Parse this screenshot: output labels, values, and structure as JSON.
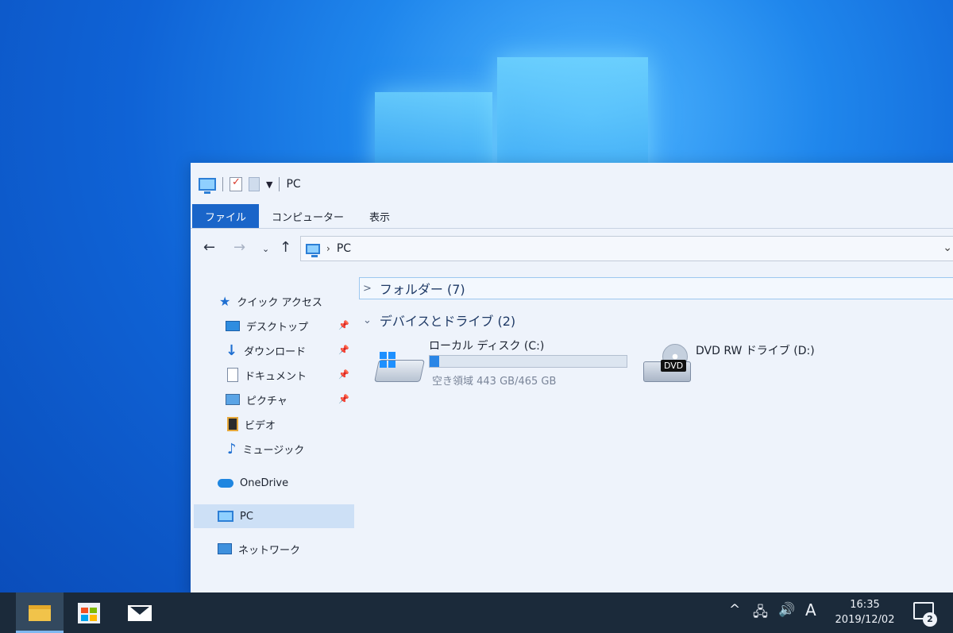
{
  "window": {
    "title": "PC",
    "ribbon_tabs": [
      "ファイル",
      "コンピューター",
      "表示"
    ],
    "address": {
      "location": "PC"
    }
  },
  "navigation_pane": {
    "quick_access": {
      "label": "クイック アクセス",
      "items": [
        {
          "label": "デスクトップ",
          "icon": "desktop-icon",
          "pinned": true
        },
        {
          "label": "ダウンロード",
          "icon": "download-icon",
          "pinned": true
        },
        {
          "label": "ドキュメント",
          "icon": "document-icon",
          "pinned": true
        },
        {
          "label": "ピクチャ",
          "icon": "pictures-icon",
          "pinned": true
        },
        {
          "label": "ビデオ",
          "icon": "video-icon",
          "pinned": false
        },
        {
          "label": "ミュージック",
          "icon": "music-icon",
          "pinned": false
        }
      ]
    },
    "onedrive": "OneDrive",
    "pc": "PC",
    "network": "ネットワーク"
  },
  "content": {
    "folders_group": "フォルダー (7)",
    "devices_group": "デバイスとドライブ (2)",
    "drives": [
      {
        "name": "ローカル ディスク (C:)",
        "free_text": "空き領域 443 GB/465 GB",
        "used_fraction": 0.047
      },
      {
        "name": "DVD RW ドライブ (D:)",
        "badge": "DVD"
      }
    ]
  },
  "taskbar": {
    "ime": "A",
    "time": "16:35",
    "date": "2019/12/02",
    "notification_count": "2"
  },
  "colors": {
    "accent": "#1a65c9",
    "taskbar": "#1b2a3a",
    "window_bg": "#eef3fb"
  }
}
